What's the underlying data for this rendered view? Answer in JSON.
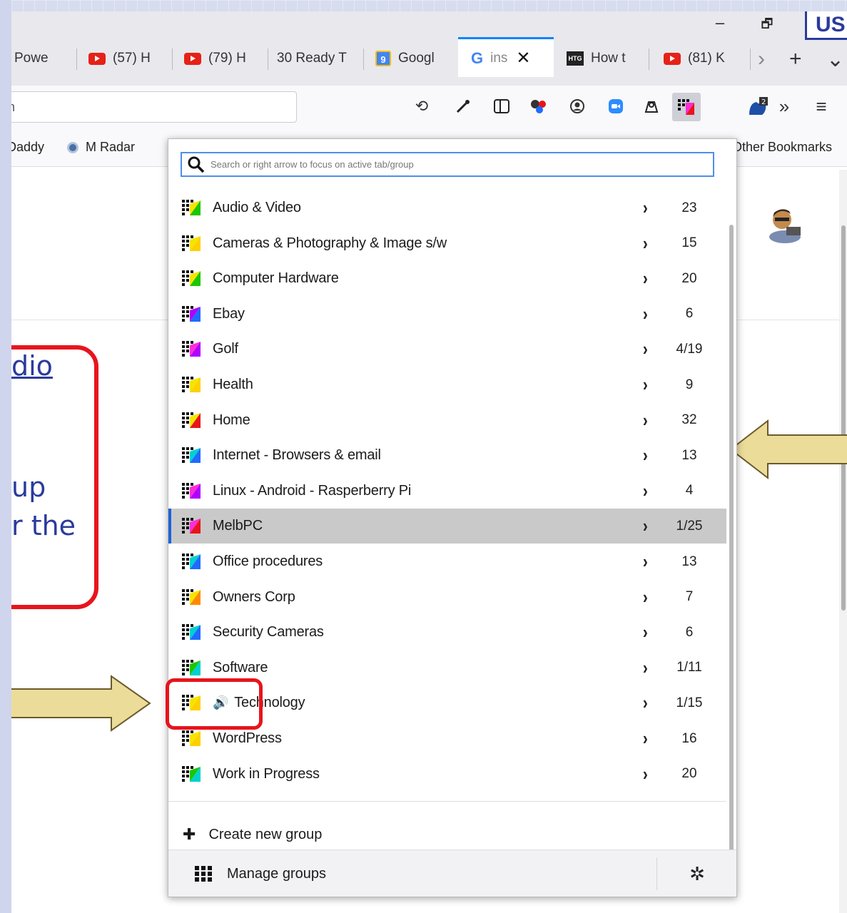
{
  "slide": {
    "callout_lines": [
      "dio",
      "up",
      "r the"
    ],
    "badge_text": "US"
  },
  "window": {
    "minimize": "–",
    "restore": "🗗"
  },
  "tabs": [
    {
      "label": "Powe",
      "icon": "none"
    },
    {
      "label": "(57) H",
      "icon": "youtube-icon"
    },
    {
      "label": "(79) H",
      "icon": "youtube-icon"
    },
    {
      "label": "30 Ready T",
      "icon": "none"
    },
    {
      "label": "Googl",
      "icon": "calendar-icon"
    },
    {
      "label": "ins",
      "icon": "google-icon",
      "active": true
    },
    {
      "label": "How t",
      "icon": "htg-icon"
    },
    {
      "label": "(81) K",
      "icon": "youtube-icon"
    }
  ],
  "tab_controls": {
    "overflow": "›",
    "new_tab": "+",
    "list_all": "⌄"
  },
  "navbar": {
    "url_text": "h",
    "more_tools": "»",
    "menu": "≡"
  },
  "bookmarks": [
    {
      "label": "Daddy"
    },
    {
      "label": "M Radar"
    },
    {
      "label": "Other Bookmarks"
    }
  ],
  "panel": {
    "search_placeholder": "Search or right arrow to focus on active tab/group",
    "groups": [
      {
        "name": "Audio & Video",
        "count": "23",
        "c1": "#f5e400",
        "c2": "#1cc700"
      },
      {
        "name": "Cameras & Photography & Image s/w",
        "count": "15",
        "c1": "#f5e400",
        "c2": "#ffd000"
      },
      {
        "name": "Computer Hardware",
        "count": "20",
        "c1": "#f5e400",
        "c2": "#1cc700"
      },
      {
        "name": "Ebay",
        "count": "6",
        "c1": "#b000ff",
        "c2": "#1e6bff"
      },
      {
        "name": "Golf",
        "count": "4/19",
        "c1": "#ff2bd6",
        "c2": "#b000ff"
      },
      {
        "name": "Health",
        "count": "9",
        "c1": "#f5e400",
        "c2": "#ffd000"
      },
      {
        "name": "Home",
        "count": "32",
        "c1": "#f5e400",
        "c2": "#e8141c"
      },
      {
        "name": "Internet - Browsers & email",
        "count": "13",
        "c1": "#00d0d0",
        "c2": "#1e6bff"
      },
      {
        "name": "Linux - Android - Rasperberry Pi",
        "count": "4",
        "c1": "#ff2bd6",
        "c2": "#b000ff"
      },
      {
        "name": "MelbPC",
        "count": "1/25",
        "c1": "#ff2bd6",
        "c2": "#e8141c",
        "selected": true
      },
      {
        "name": "Office procedures",
        "count": "13",
        "c1": "#00d0d0",
        "c2": "#1e6bff"
      },
      {
        "name": "Owners Corp",
        "count": "7",
        "c1": "#f5e400",
        "c2": "#ff8a00"
      },
      {
        "name": "Security Cameras",
        "count": "6",
        "c1": "#00d0d0",
        "c2": "#1e6bff"
      },
      {
        "name": "Software",
        "count": "1/11",
        "c1": "#1cc700",
        "c2": "#00d0d0"
      },
      {
        "name": "Technology",
        "count": "1/15",
        "c1": "#f5e400",
        "c2": "#ffd000",
        "playing": true
      },
      {
        "name": "WordPress",
        "count": "16",
        "c1": "#f5e400",
        "c2": "#ffd000"
      },
      {
        "name": "Work in Progress",
        "count": "20",
        "c1": "#1cc700",
        "c2": "#00d0d0"
      }
    ],
    "create_label": "Create new group",
    "manage_label": "Manage groups"
  },
  "colors": {
    "accent": "#0a84ff",
    "selection": "#c9c9c9",
    "callout_red": "#e8141c",
    "slide_text": "#2a3b9c",
    "arrow_fill": "#ecdc9a"
  }
}
